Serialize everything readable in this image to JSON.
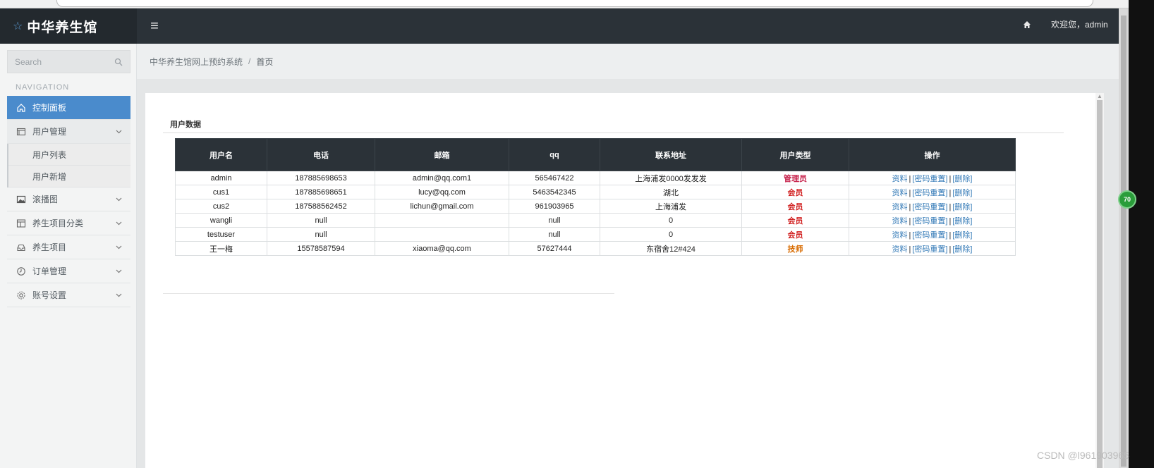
{
  "header": {
    "brand": "中华养生馆",
    "welcome": "欢迎您，admin"
  },
  "sidebar": {
    "search_placeholder": "Search",
    "nav_heading": "NAVIGATION",
    "items": [
      {
        "label": "控制面板",
        "icon": "home-icon"
      },
      {
        "label": "用户管理",
        "icon": "window-icon"
      },
      {
        "label": "滚播图",
        "icon": "image-icon"
      },
      {
        "label": "养生项目分类",
        "icon": "layout-icon"
      },
      {
        "label": "养生项目",
        "icon": "inbox-icon"
      },
      {
        "label": "订单管理",
        "icon": "clock-icon"
      },
      {
        "label": "账号设置",
        "icon": "gear-icon"
      }
    ],
    "user_sub": [
      "用户列表",
      "用户新增"
    ]
  },
  "breadcrumb": {
    "root": "中华养生馆网上预约系统",
    "separator": "/",
    "current": "首页"
  },
  "panel": {
    "title": "用户数据"
  },
  "table": {
    "columns": [
      "用户名",
      "电话",
      "邮箱",
      "qq",
      "联系地址",
      "用户类型",
      "操作"
    ],
    "rows": [
      {
        "name": "admin",
        "phone": "187885698653",
        "email": "admin@qq.com1",
        "qq": "565467422",
        "address": "上海浦发0000发发发",
        "type": "管理员"
      },
      {
        "name": "cus1",
        "phone": "187885698651",
        "email": "lucy@qq.com",
        "qq": "5463542345",
        "address": "湖北",
        "type": "会员"
      },
      {
        "name": "cus2",
        "phone": "187588562452",
        "email": "lichun@gmail.com",
        "qq": "961903965",
        "address": "上海浦发",
        "type": "会员"
      },
      {
        "name": "wangli",
        "phone": "null",
        "email": "",
        "qq": "null",
        "address": "0",
        "type": "会员"
      },
      {
        "name": "testuser",
        "phone": "null",
        "email": "",
        "qq": "null",
        "address": "0",
        "type": "会员"
      },
      {
        "name": "王一梅",
        "phone": "15578587594",
        "email": "xiaoma@qq.com",
        "qq": "57627444",
        "address": "东宿舍12#424",
        "type": "技师"
      }
    ],
    "actions": [
      "资料",
      "[密码重置]",
      "[删除]"
    ],
    "action_separator": "|"
  },
  "overlay": {
    "badge": "70",
    "watermark": "CSDN @l961903965"
  },
  "colors": {
    "header_bg": "#2b3238",
    "sidebar_active": "#4a8bcc",
    "link": "#337ab7",
    "type_highlight": "#d01c1c"
  }
}
